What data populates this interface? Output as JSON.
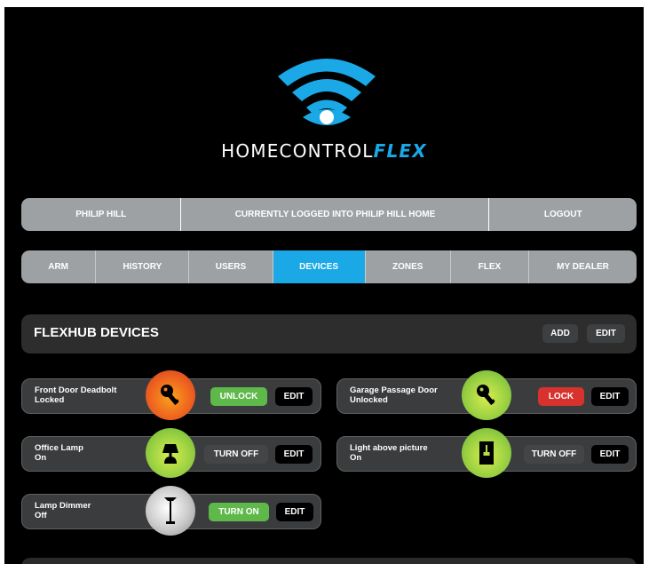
{
  "brand": {
    "name_main": "HOMECONTROL",
    "name_accent": "FLEX",
    "accent_color": "#1aa9e6"
  },
  "userbar": {
    "user": "PHILIP HILL",
    "status": "CURRENTLY LOGGED INTO PHILIP HILL HOME",
    "logout": "LOGOUT"
  },
  "nav": {
    "tabs": [
      "ARM",
      "HISTORY",
      "USERS",
      "DEVICES",
      "ZONES",
      "FLEX",
      "MY DEALER"
    ],
    "active": "DEVICES"
  },
  "panel": {
    "title": "FLEXHUB DEVICES",
    "add": "ADD",
    "edit": "EDIT"
  },
  "devices": [
    {
      "name": "Front Door Deadbolt",
      "status": "Locked",
      "icon": "key-icon",
      "action": "UNLOCK",
      "edit": "EDIT"
    },
    {
      "name": "Garage Passage Door",
      "status": "Unlocked",
      "icon": "key-icon",
      "action": "LOCK",
      "edit": "EDIT"
    },
    {
      "name": "Office Lamp",
      "status": "On",
      "icon": "lamp-icon",
      "action": "TURN OFF",
      "edit": "EDIT"
    },
    {
      "name": "Light above picture",
      "status": "On",
      "icon": "light-switch-icon",
      "action": "TURN OFF",
      "edit": "EDIT"
    },
    {
      "name": "Lamp Dimmer",
      "status": "Off",
      "icon": "floor-lamp-icon",
      "action": "TURN ON",
      "edit": "EDIT"
    }
  ]
}
